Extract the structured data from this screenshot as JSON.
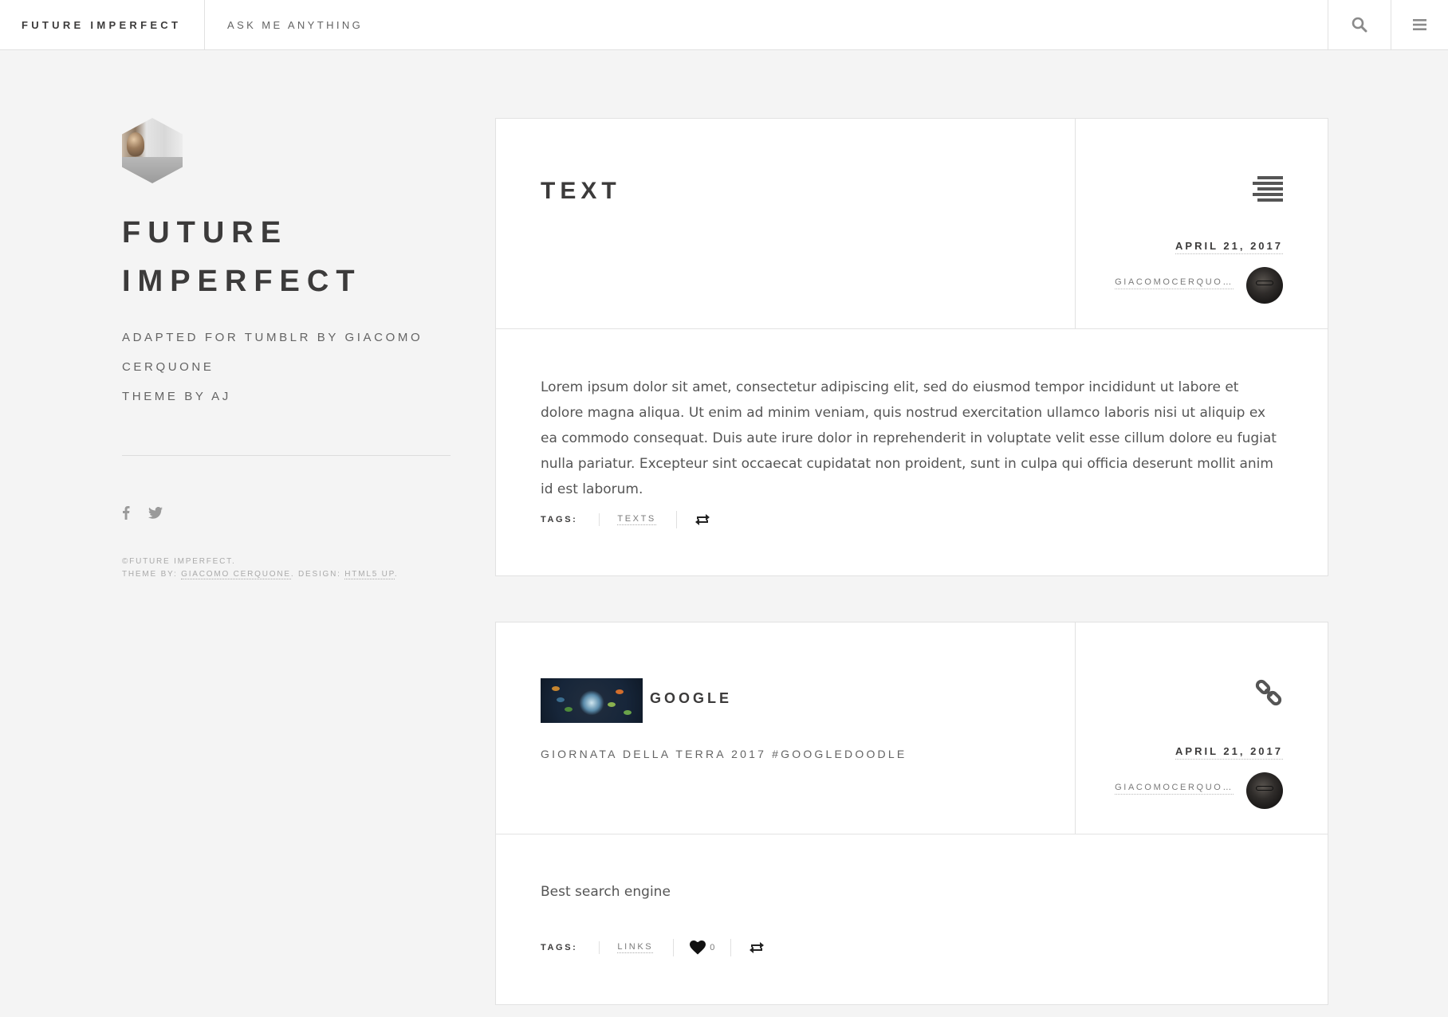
{
  "header": {
    "brand": "FUTURE IMPERFECT",
    "nav_link": "ASK ME ANYTHING",
    "search_icon": "search-icon",
    "menu_icon": "menu-icon"
  },
  "sidebar": {
    "title_line1": "FUTURE",
    "title_line2": "IMPERFECT",
    "desc_line1": "ADAPTED FOR TUMBLR BY GIACOMO",
    "desc_line2": "CERQUONE",
    "desc_line3": "THEME BY AJ",
    "social": [
      "facebook-icon",
      "twitter-icon"
    ],
    "copyright": {
      "line1": "©FUTURE IMPERFECT.",
      "theme_by_label": "THEME BY: ",
      "theme_by_link": "GIACOMO CERQUONE",
      "design_label": ". DESIGN: ",
      "design_link": "HTML5 UP",
      "end": "."
    }
  },
  "posts": [
    {
      "title": "TEXT",
      "type_icon": "text-align-icon",
      "date": "APRIL 21, 2017",
      "author": "GIACOMOCERQUO…",
      "body": "Lorem ipsum dolor sit amet, consectetur adipiscing elit, sed do eiusmod tempor incididunt ut labore et dolore magna aliqua. Ut enim ad minim veniam, quis nostrud exercitation ullamco laboris nisi ut aliquip ex ea commodo consequat. Duis aute irure dolor in reprehenderit in voluptate velit esse cillum dolore eu fugiat nulla pariatur. Excepteur sint occaecat cupidatat non proident, sunt in culpa qui officia deserunt mollit anim id est laborum.",
      "tags_label": "TAGS:",
      "tags": [
        "TEXTS"
      ],
      "reblog_icon": "reblog-icon"
    },
    {
      "title": "GOOGLE",
      "subtitle": "GIORNATA DELLA TERRA 2017 #GOOGLEDOODLE",
      "type_icon": "link-icon",
      "date": "APRIL 21, 2017",
      "author": "GIACOMOCERQUO…",
      "body": "Best search engine",
      "tags_label": "TAGS:",
      "tags": [
        "LINKS"
      ],
      "like_icon": "heart-icon",
      "like_count": "0",
      "reblog_icon": "reblog-icon"
    }
  ],
  "colors": {
    "background": "#f4f4f4",
    "panel": "#ffffff",
    "text_dark": "#3c3b3b",
    "text_muted": "#646464",
    "border": "#e2e2e2"
  }
}
